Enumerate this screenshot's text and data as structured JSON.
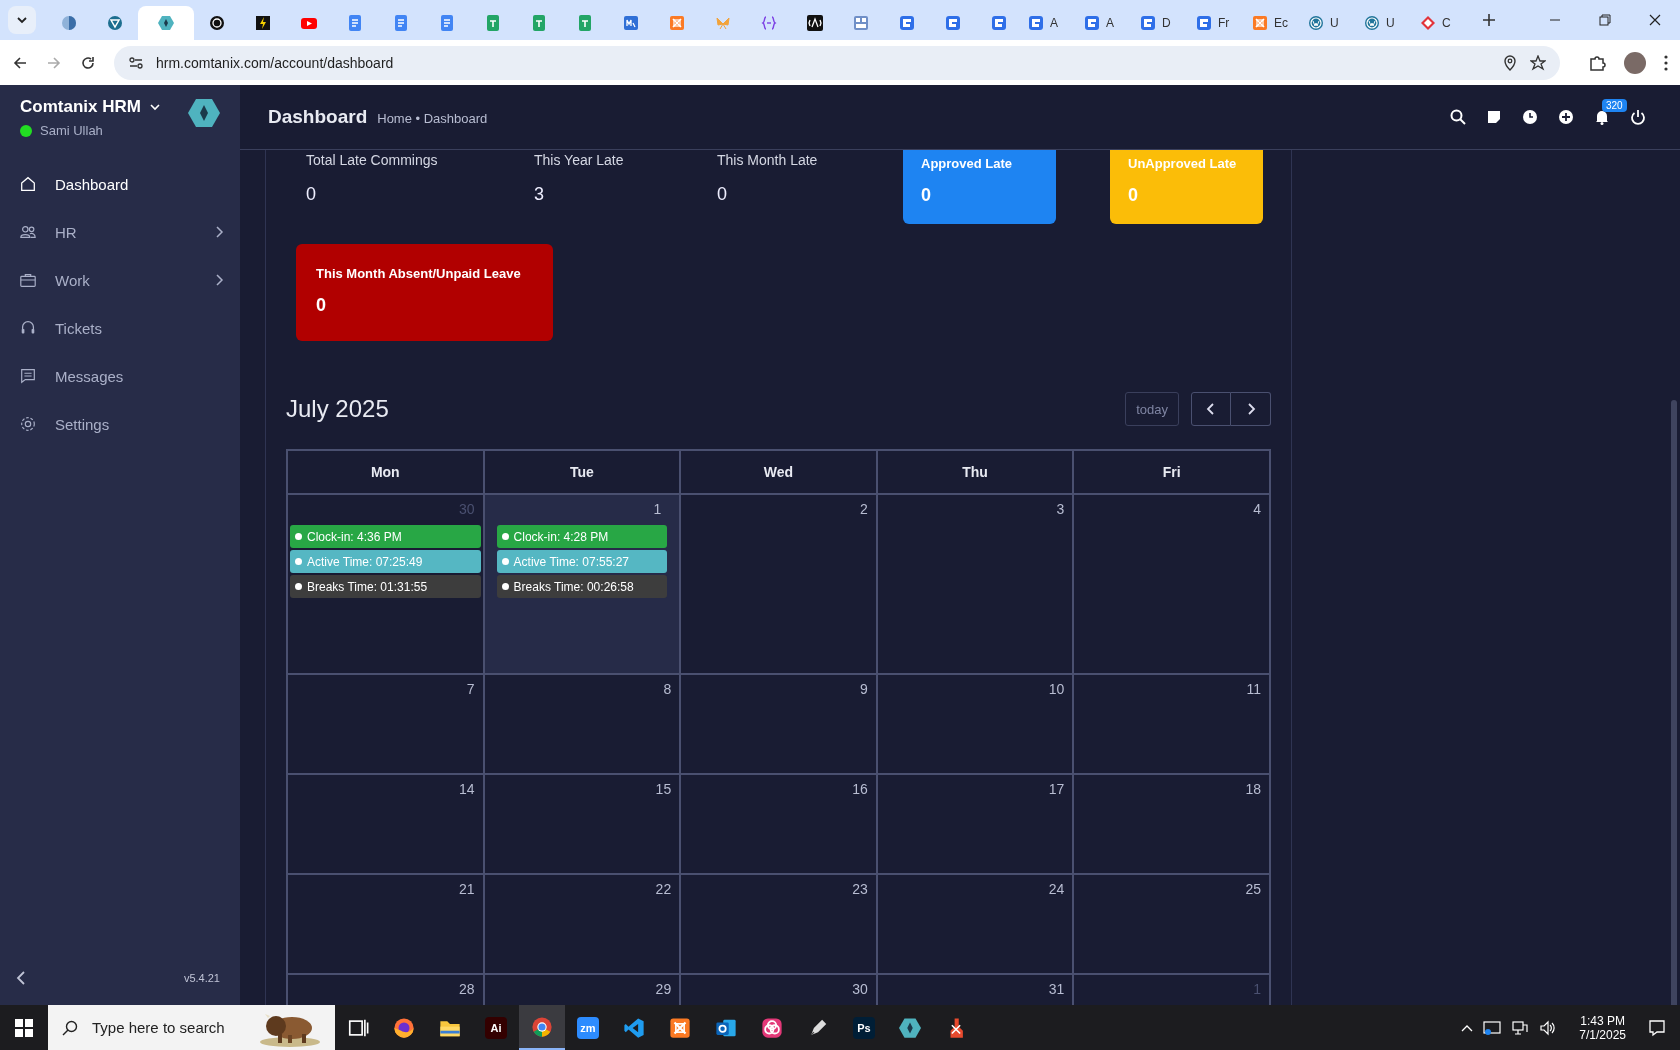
{
  "browser": {
    "tabs": [
      {
        "kind": "globe",
        "selected": false
      },
      {
        "kind": "vpn",
        "selected": false
      },
      {
        "kind": "hex",
        "selected": true
      },
      {
        "kind": "ai",
        "selected": false
      },
      {
        "kind": "bolt",
        "selected": false
      },
      {
        "kind": "video",
        "selected": false
      },
      {
        "kind": "doc",
        "selected": false
      },
      {
        "kind": "doc",
        "selected": false
      },
      {
        "kind": "doc",
        "selected": false
      },
      {
        "kind": "sheet",
        "selected": false
      },
      {
        "kind": "sheet",
        "selected": false
      },
      {
        "kind": "sheet",
        "selected": false
      },
      {
        "kind": "chart",
        "selected": false
      },
      {
        "kind": "xampp",
        "selected": false
      },
      {
        "kind": "fly",
        "selected": false
      },
      {
        "kind": "code",
        "selected": false
      },
      {
        "kind": "dark",
        "selected": false
      },
      {
        "kind": "grid",
        "selected": false
      },
      {
        "kind": "form",
        "selected": false
      },
      {
        "kind": "form",
        "selected": false
      },
      {
        "kind": "form",
        "selected": false
      },
      {
        "kind": "form",
        "title": "A",
        "selected": false
      },
      {
        "kind": "form",
        "title": "A",
        "selected": false
      },
      {
        "kind": "form",
        "title": "D",
        "selected": false
      },
      {
        "kind": "form",
        "title": "Fr",
        "selected": false
      },
      {
        "kind": "xampp",
        "title": "Ec",
        "selected": false
      },
      {
        "kind": "wp",
        "title": "U",
        "selected": false
      },
      {
        "kind": "wp",
        "title": "U",
        "selected": false
      },
      {
        "kind": "gem",
        "title": "C",
        "selected": false
      }
    ],
    "address": "hrm.comtanix.com/account/dashboard"
  },
  "sidebar": {
    "brand": "Comtanix HRM",
    "user": "Sami Ullah",
    "online": true,
    "items": [
      {
        "kind": "home",
        "label": "Dashboard",
        "selected": true,
        "submenu": false
      },
      {
        "kind": "users",
        "label": "HR",
        "selected": false,
        "submenu": true
      },
      {
        "kind": "briefcase",
        "label": "Work",
        "selected": false,
        "submenu": true
      },
      {
        "kind": "headset",
        "label": "Tickets",
        "selected": false,
        "submenu": false
      },
      {
        "kind": "chat",
        "label": "Messages",
        "selected": false,
        "submenu": false
      },
      {
        "kind": "gear",
        "label": "Settings",
        "selected": false,
        "submenu": false
      }
    ],
    "version": "v5.4.21"
  },
  "header": {
    "title": "Dashboard",
    "breadcrumb": "Home • Dashboard",
    "notification_count": "320"
  },
  "stats": [
    {
      "kind": "plain",
      "label": "Total Late Commings",
      "value": "0"
    },
    {
      "kind": "plain",
      "label": "This Year Late",
      "value": "3"
    },
    {
      "kind": "plain",
      "label": "This Month Late",
      "value": "0"
    },
    {
      "kind": "card",
      "label": "Approved Late",
      "value": "0",
      "color": "#1e84f2"
    },
    {
      "kind": "card",
      "label": "UnApproved Late",
      "value": "0",
      "color": "#fbbd08"
    },
    {
      "kind": "card",
      "label": "This Month Absent/Unpaid Leave",
      "value": "0",
      "color": "#b10000"
    }
  ],
  "calendar": {
    "title": "July 2025",
    "today_button": "today",
    "weekdays": [
      "Mon",
      "Tue",
      "Wed",
      "Thu",
      "Fri"
    ],
    "weeks": [
      [
        {
          "day": "30",
          "other_month": true,
          "today": false,
          "events": [
            {
              "text": "Clock-in: 4:36 PM",
              "color": "#28a745"
            },
            {
              "text": "Active Time: 07:25:49",
              "color": "#55b7c3"
            },
            {
              "text": "Breaks Time: 01:31:55",
              "color": "#3d3d3d"
            }
          ]
        },
        {
          "day": "1",
          "other_month": false,
          "today": true,
          "events": [
            {
              "text": "Clock-in: 4:28 PM",
              "color": "#28a745"
            },
            {
              "text": "Active Time: 07:55:27",
              "color": "#55b7c3"
            },
            {
              "text": "Breaks Time: 00:26:58",
              "color": "#3d3d3d"
            }
          ]
        },
        {
          "day": "2",
          "other_month": false,
          "today": false
        },
        {
          "day": "3",
          "other_month": false,
          "today": false
        },
        {
          "day": "4",
          "other_month": false,
          "today": false
        }
      ],
      [
        {
          "day": "7",
          "other_month": false,
          "today": false
        },
        {
          "day": "8",
          "other_month": false,
          "today": false
        },
        {
          "day": "9",
          "other_month": false,
          "today": false
        },
        {
          "day": "10",
          "other_month": false,
          "today": false
        },
        {
          "day": "11",
          "other_month": false,
          "today": false
        }
      ],
      [
        {
          "day": "14",
          "other_month": false,
          "today": false
        },
        {
          "day": "15",
          "other_month": false,
          "today": false
        },
        {
          "day": "16",
          "other_month": false,
          "today": false
        },
        {
          "day": "17",
          "other_month": false,
          "today": false
        },
        {
          "day": "18",
          "other_month": false,
          "today": false
        }
      ],
      [
        {
          "day": "21",
          "other_month": false,
          "today": false
        },
        {
          "day": "22",
          "other_month": false,
          "today": false
        },
        {
          "day": "23",
          "other_month": false,
          "today": false
        },
        {
          "day": "24",
          "other_month": false,
          "today": false
        },
        {
          "day": "25",
          "other_month": false,
          "today": false
        }
      ],
      [
        {
          "day": "28",
          "other_month": false,
          "today": false
        },
        {
          "day": "29",
          "other_month": false,
          "today": false
        },
        {
          "day": "30",
          "other_month": false,
          "today": false
        },
        {
          "day": "31",
          "other_month": false,
          "today": false
        },
        {
          "day": "1",
          "other_month": true,
          "today": false
        }
      ]
    ]
  },
  "taskbar": {
    "search_placeholder": "Type here to search",
    "apps": [
      {
        "kind": "taskview",
        "selected": false
      },
      {
        "kind": "firefox",
        "selected": false
      },
      {
        "kind": "folder",
        "selected": false
      },
      {
        "kind": "label",
        "label": "Ai",
        "color": "#330000",
        "selected": false
      },
      {
        "kind": "chrome",
        "selected": true
      },
      {
        "kind": "label",
        "label": "zm",
        "color": "#2d8cff",
        "selected": false
      },
      {
        "kind": "vscode",
        "selected": false
      },
      {
        "kind": "xampp",
        "selected": false
      },
      {
        "kind": "outlook",
        "selected": false
      },
      {
        "kind": "cc",
        "selected": false
      },
      {
        "kind": "pen",
        "selected": false
      },
      {
        "kind": "label",
        "label": "Ps",
        "color": "#001e36",
        "selected": false
      },
      {
        "kind": "hex",
        "selected": false
      },
      {
        "kind": "tool",
        "selected": false
      }
    ],
    "time": "1:43 PM",
    "date": "7/1/2025"
  }
}
